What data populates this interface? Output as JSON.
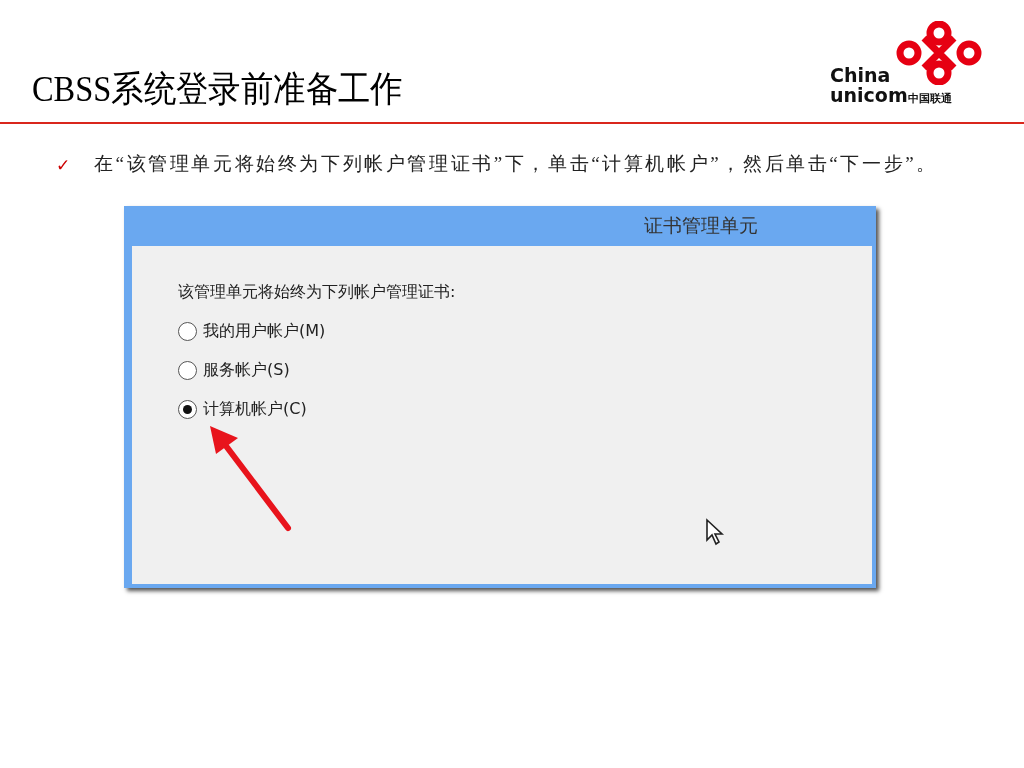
{
  "slide": {
    "title": "CBSS系统登录前准备工作",
    "logo": {
      "line_1": "China",
      "line_2": "unicom",
      "line_2_cn": "中国联通"
    },
    "bullet": {
      "mark": "✓",
      "text": "在“该管理单元将始终为下列帐户管理证书”下，单击“计算机帐户”，然后单击“下一步”。"
    }
  },
  "dialog": {
    "title": "证书管理单元",
    "prompt": "该管理单元将始终为下列帐户管理证书:",
    "options": [
      {
        "label": "我的用户帐户(M)",
        "selected": false
      },
      {
        "label": "服务帐户(S)",
        "selected": false
      },
      {
        "label": "计算机帐户(C)",
        "selected": true
      }
    ]
  }
}
